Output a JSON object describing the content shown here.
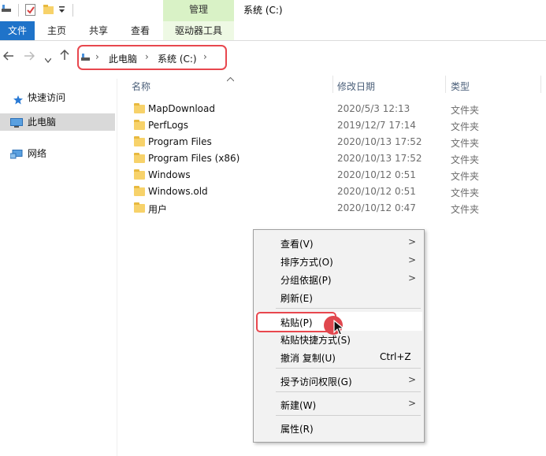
{
  "window": {
    "title": "系统 (C:)"
  },
  "ribbon": {
    "manage_label": "管理",
    "tabs": [
      "文件",
      "主页",
      "共享",
      "查看"
    ],
    "drive_tools": "驱动器工具"
  },
  "address": {
    "parts": [
      "此电脑",
      "系统 (C:)"
    ]
  },
  "nav": {
    "items": [
      {
        "label": "快速访问",
        "icon": "star-icon"
      },
      {
        "label": "此电脑",
        "icon": "computer-icon"
      },
      {
        "label": "网络",
        "icon": "network-icon"
      }
    ]
  },
  "list": {
    "headers": {
      "name": "名称",
      "date": "修改日期",
      "type": "类型"
    },
    "rows": [
      {
        "name": "MapDownload",
        "date": "2020/5/3 12:13",
        "type": "文件夹"
      },
      {
        "name": "PerfLogs",
        "date": "2019/12/7 17:14",
        "type": "文件夹"
      },
      {
        "name": "Program Files",
        "date": "2020/10/13 17:52",
        "type": "文件夹"
      },
      {
        "name": "Program Files (x86)",
        "date": "2020/10/13 17:52",
        "type": "文件夹"
      },
      {
        "name": "Windows",
        "date": "2020/10/12 0:51",
        "type": "文件夹"
      },
      {
        "name": "Windows.old",
        "date": "2020/10/12 0:51",
        "type": "文件夹"
      },
      {
        "name": "用户",
        "date": "2020/10/12 0:47",
        "type": "文件夹"
      }
    ]
  },
  "context_menu": {
    "items": [
      {
        "label": "查看(V)",
        "submenu": true
      },
      {
        "label": "排序方式(O)",
        "submenu": true
      },
      {
        "label": "分组依据(P)",
        "submenu": true
      },
      {
        "label": "刷新(E)",
        "submenu": false
      },
      {
        "label": "粘贴(P)",
        "submenu": false
      },
      {
        "label": "粘贴快捷方式(S)",
        "submenu": false
      },
      {
        "label": "撤消 复制(U)",
        "shortcut": "Ctrl+Z",
        "submenu": false
      },
      {
        "label": "授予访问权限(G)",
        "submenu": true
      },
      {
        "label": "新建(W)",
        "submenu": true
      },
      {
        "label": "属性(R)",
        "submenu": false
      }
    ]
  },
  "colors": {
    "accent": "#1f73c9",
    "manage_tab": "#d9f2c6",
    "highlight": "#e8474e",
    "folder": "#f7d26a"
  }
}
